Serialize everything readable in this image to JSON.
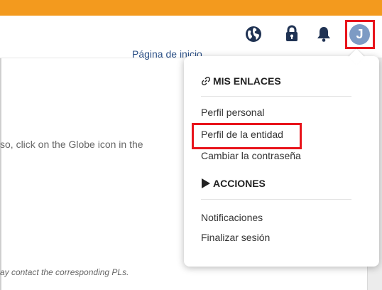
{
  "header": {
    "home_link": "Página de inicio",
    "icons": [
      "globe-icon",
      "lock-icon",
      "bell-icon"
    ],
    "avatar_initial": "J",
    "accent_color": "#f39a1e"
  },
  "background": {
    "body_text": "so, click on the Globe icon in the",
    "note_text": "ay contact the corresponding PLs."
  },
  "dropdown": {
    "section_links_title": "MIS ENLACES",
    "links": [
      "Perfil personal",
      "Perfil de la entidad",
      "Cambiar la contraseña"
    ],
    "section_actions_title": "ACCIONES",
    "actions": [
      "Notificaciones",
      "Finalizar sesión"
    ]
  },
  "highlights": {
    "color": "#e8141b",
    "targets": [
      "avatar",
      "Perfil de la entidad"
    ]
  }
}
